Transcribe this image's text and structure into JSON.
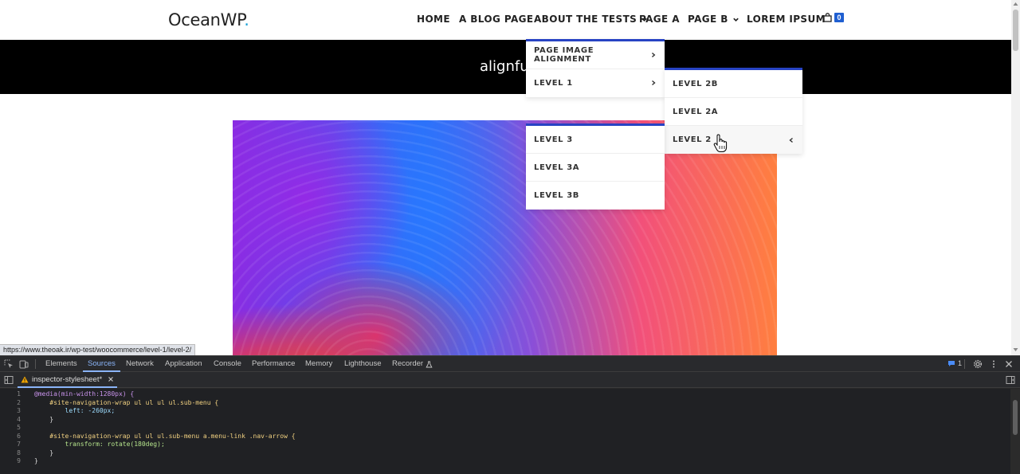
{
  "site": {
    "logo": "OceanWP",
    "logo_dot": ".",
    "nav": [
      {
        "label": "HOME",
        "has_dropdown": false
      },
      {
        "label": "A BLOG PAGE",
        "has_dropdown": false
      },
      {
        "label": "ABOUT THE TESTS",
        "has_dropdown": true
      },
      {
        "label": "PAGE A",
        "has_dropdown": false
      },
      {
        "label": "PAGE B",
        "has_dropdown": true
      },
      {
        "label": "LOREM IPSUM",
        "has_dropdown": false
      }
    ],
    "cart_count": "0",
    "page_title": "alignfull"
  },
  "menus": {
    "level1": [
      {
        "label": "PAGE IMAGE ALIGNMENT",
        "arrow": "right"
      },
      {
        "label": "LEVEL 1",
        "arrow": "right"
      }
    ],
    "level2": [
      {
        "label": "LEVEL 2B"
      },
      {
        "label": "LEVEL 2A"
      },
      {
        "label": "LEVEL 2",
        "arrow": "left",
        "active": true
      }
    ],
    "level3": [
      {
        "label": "LEVEL 3"
      },
      {
        "label": "LEVEL 3A"
      },
      {
        "label": "LEVEL 3B"
      }
    ]
  },
  "status_url": "https://www.theoak.ir/wp-test/woocommerce/level-1/level-2/",
  "devtools": {
    "tabs": [
      "Elements",
      "Sources",
      "Network",
      "Application",
      "Console",
      "Performance",
      "Memory",
      "Lighthouse",
      "Recorder"
    ],
    "active_tab": "Sources",
    "issues_count": "1",
    "file_tab": "inspector-stylesheet*",
    "line_numbers": [
      "1",
      "2",
      "3",
      "4",
      "5",
      "6",
      "7",
      "8",
      "9"
    ],
    "code_lines": [
      "@media(min-width:1280px) {",
      "    #site-navigation-wrap ul ul ul ul.sub-menu {",
      "        left: -260px;",
      "    }",
      "",
      "    #site-navigation-wrap ul ul ul.sub-menu a.menu-link .nav-arrow {",
      "        transform: rotate(180deg);",
      "    }",
      "}"
    ]
  },
  "colors": {
    "accent": "#2743c4",
    "cart_badge": "#1f5fd1",
    "devtools_active": "#8ab4f8"
  }
}
